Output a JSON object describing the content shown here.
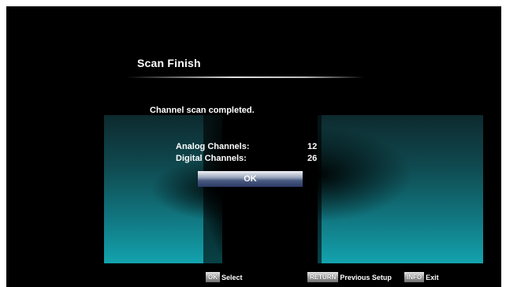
{
  "dialog": {
    "title": "Scan Finish",
    "message": "Channel scan completed.",
    "counts": [
      {
        "label": "Analog Channels:",
        "value": "12"
      },
      {
        "label": "Digital Channels:",
        "value": "26"
      }
    ],
    "ok_label": "OK"
  },
  "footer": {
    "hints": [
      {
        "key": "OK",
        "action": "Select"
      },
      {
        "key": "RETURN",
        "action": "Previous Setup"
      },
      {
        "key": "INFO",
        "action": "Exit"
      }
    ]
  },
  "colors": {
    "background": "#000000",
    "text": "#ffffff",
    "panel_glow": "#13a3ae",
    "button_dark": "#2c3a66"
  }
}
